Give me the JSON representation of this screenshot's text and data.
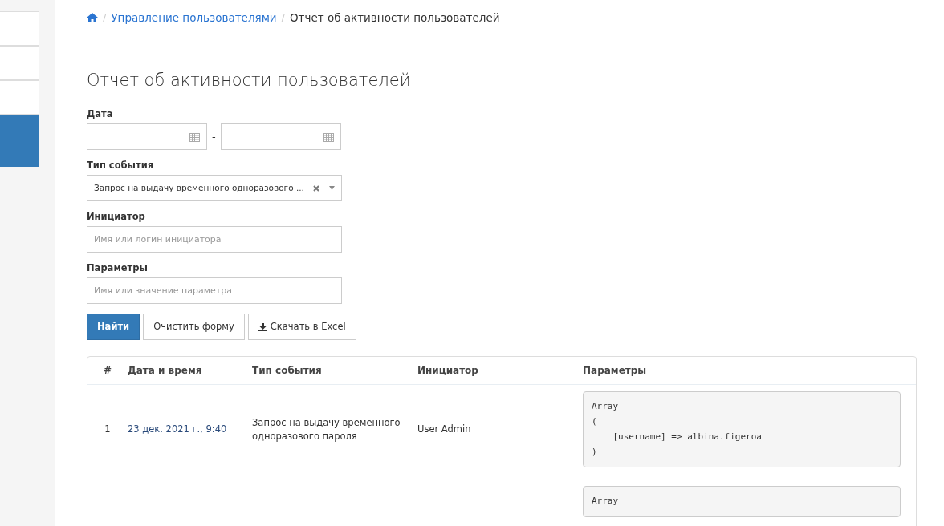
{
  "sidebar": {
    "items": [
      {
        "selected": false
      },
      {
        "selected": false
      },
      {
        "selected": false
      },
      {
        "selected": true
      }
    ]
  },
  "breadcrumb": [
    {
      "separator": "/",
      "label": "Управление пользователями",
      "kind": "link"
    },
    {
      "separator": "/",
      "label": "Отчет об активности пользователей",
      "kind": "current"
    }
  ],
  "title": "Отчет об активности пользователей",
  "form": {
    "date": {
      "label": "Дата",
      "separator": "-"
    },
    "event_type": {
      "label": "Тип события",
      "value": "Запрос на выдачу временного одноразового ..."
    },
    "initiator": {
      "label": "Инициатор",
      "placeholder": "Имя или логин инициатора"
    },
    "params": {
      "label": "Параметры",
      "placeholder": "Имя или значение параметра"
    },
    "buttons": [
      {
        "label": "Найти",
        "kind": "primary"
      },
      {
        "label": "Очистить форму",
        "kind": "default"
      },
      {
        "label": "Скачать в Excel",
        "kind": "download"
      }
    ]
  },
  "table": {
    "columns": [
      "#",
      "Дата и время",
      "Тип события",
      "Инициатор",
      "Параметры"
    ],
    "rows": [
      {
        "cells": [
          "1",
          "23 дек. 2021 г., 9:40",
          "Запрос на выдачу временного одноразового пароля",
          "User Admin"
        ],
        "params": "Array\n(\n    [username] => albina.figeroa\n)"
      },
      {
        "cells": [],
        "params": "Array"
      }
    ]
  }
}
